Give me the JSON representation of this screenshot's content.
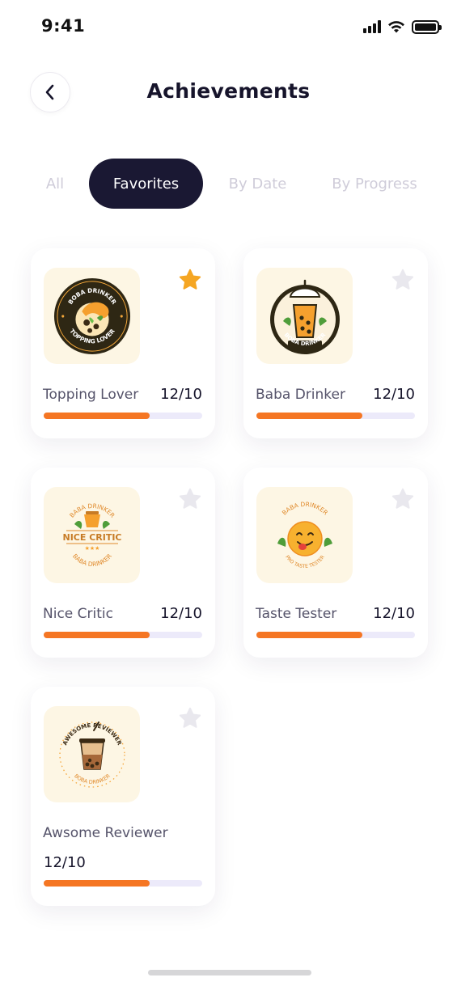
{
  "status_bar": {
    "time": "9:41"
  },
  "header": {
    "title": "Achievements"
  },
  "tabs": [
    {
      "label": "All",
      "active": false
    },
    {
      "label": "Favorites",
      "active": true
    },
    {
      "label": "By Date",
      "active": false
    },
    {
      "label": "By Progress",
      "active": false
    }
  ],
  "achievements": [
    {
      "name": "Topping Lover",
      "progress": "12/10",
      "fill_fraction": 0.67,
      "favorite": true,
      "badge": {
        "top_text": "BOBA DRINKER",
        "bottom_text": "TOPPING LOVER",
        "icon": "boba-splash-icon"
      }
    },
    {
      "name": "Baba Drinker",
      "progress": "12/10",
      "fill_fraction": 0.67,
      "favorite": false,
      "badge": {
        "bottom_text": "BOBA DRINKER",
        "icon": "boba-cup-icon"
      }
    },
    {
      "name": "Nice Critic",
      "progress": "12/10",
      "fill_fraction": 0.67,
      "favorite": false,
      "badge": {
        "top_text": "BABA DRINKER",
        "center_text": "NICE CRITIC",
        "bottom_text": "BABA DRINKER",
        "icon": "tea-cup-icon"
      }
    },
    {
      "name": "Taste Tester",
      "progress": "12/10",
      "fill_fraction": 0.67,
      "favorite": false,
      "badge": {
        "top_text": "BABA DRINKER",
        "bottom_text": "PRO TASTE TESTER",
        "icon": "yum-face-icon"
      }
    },
    {
      "name": "Awsome Reviewer",
      "progress": "12/10",
      "fill_fraction": 0.67,
      "favorite": false,
      "badge": {
        "top_text": "AWESOME REVIEWER",
        "bottom_text": "BOBA DRINKER",
        "icon": "bubble-tea-icon"
      }
    }
  ],
  "colors": {
    "accent": "#f57623",
    "dark": "#1a1833",
    "star_active": "#f5a623",
    "star_inactive": "#e9e8ee",
    "badge_bg": "#fdf6e4",
    "track": "#eceafa"
  }
}
